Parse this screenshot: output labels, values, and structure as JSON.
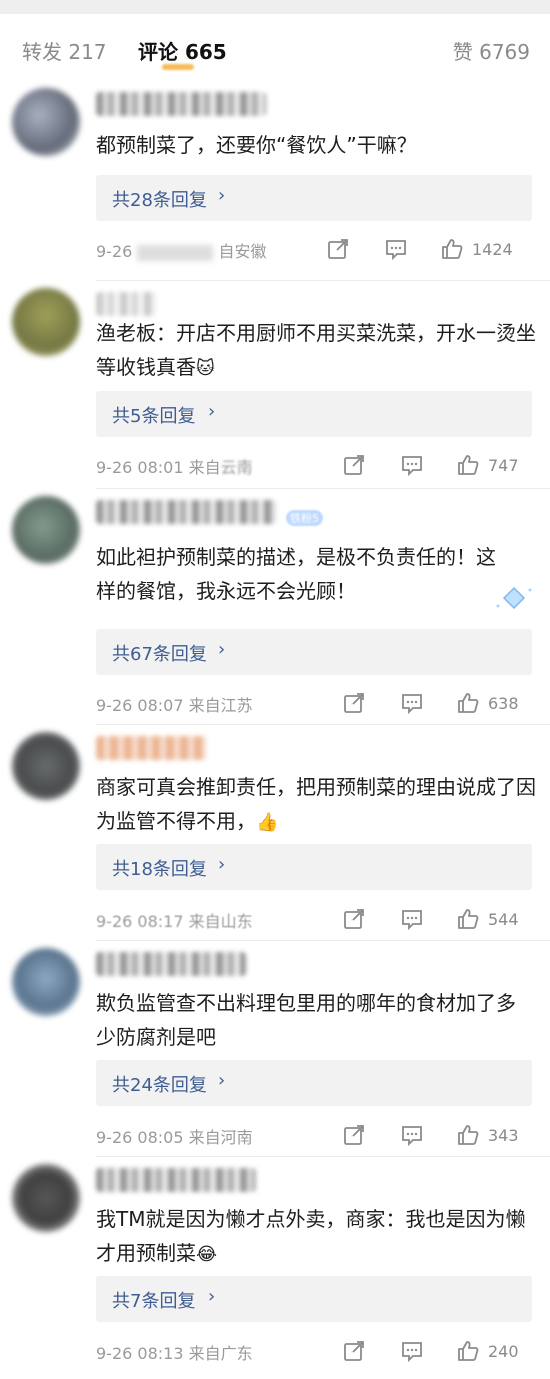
{
  "tabs": {
    "repost": "转发 217",
    "comments": "评论 665",
    "likes": "赞 6769"
  },
  "comments": [
    {
      "text": "都预制菜了，还要你“餐饮人”干嘛？",
      "reply": "共28条回复",
      "meta": "9-26",
      "location": "自安徽",
      "likes": "1424"
    },
    {
      "text": "渔老板：开店不用厨师不用买菜洗菜，开水一烫坐等收钱真香",
      "emoji": "🐱",
      "reply": "共5条回复",
      "meta": "9-26 08:01 来自",
      "location": "云南",
      "likes": "747"
    },
    {
      "text": "如此袒护预制菜的描述，是极不负责任的！这样的餐馆，我永远不会光顾！",
      "badge": "铁粉5",
      "reply": "共67条回复",
      "meta": "9-26 08:07 来自江苏",
      "likes": "638"
    },
    {
      "text": "商家可真会推卸责任，把用预制菜的理由说成了因为监管不得不用，",
      "emoji": "👍",
      "reply": "共18条回复",
      "meta": "9-26 08:17 来自山东",
      "likes": "544"
    },
    {
      "text": "欺负监管查不出料理包里用的哪年的食材加了多少防腐剂是吧",
      "reply": "共24条回复",
      "meta": "9-26 08:05 来自河南",
      "likes": "343"
    },
    {
      "text": "我TM就是因为懒才点外卖，商家：我也是因为懒才用预制菜",
      "emoji": "😂",
      "reply": "共7条回复",
      "meta": "9-26 08:13 来自广东",
      "likes": "240"
    }
  ],
  "icons": {
    "repost": "share-icon",
    "comment": "comment-icon",
    "like": "thumb-up-icon",
    "reply_chevron": "chevron-right-icon"
  },
  "colors": {
    "reply_link": "#3f5d92",
    "meta_text": "#9a9a9a",
    "reply_bg": "#f2f2f2"
  }
}
